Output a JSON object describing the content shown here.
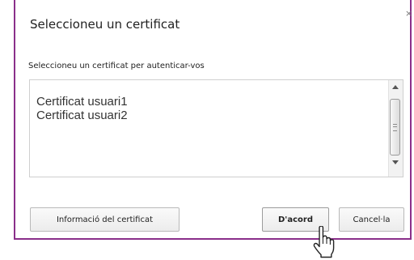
{
  "dialog": {
    "title": "Seleccioneu un certificat",
    "close_glyph": "×",
    "prompt": "Seleccioneu un certificat per autenticar-vos"
  },
  "certificates": [
    "Certificat usuari1",
    "Certificat usuari2"
  ],
  "buttons": {
    "info_label": "Informació del certificat",
    "ok_label": "D'acord",
    "cancel_label": "Cancel·la"
  },
  "colors": {
    "frame": "#8a2f8a"
  },
  "icons": {
    "cursor": "hand-pointer-cursor"
  }
}
